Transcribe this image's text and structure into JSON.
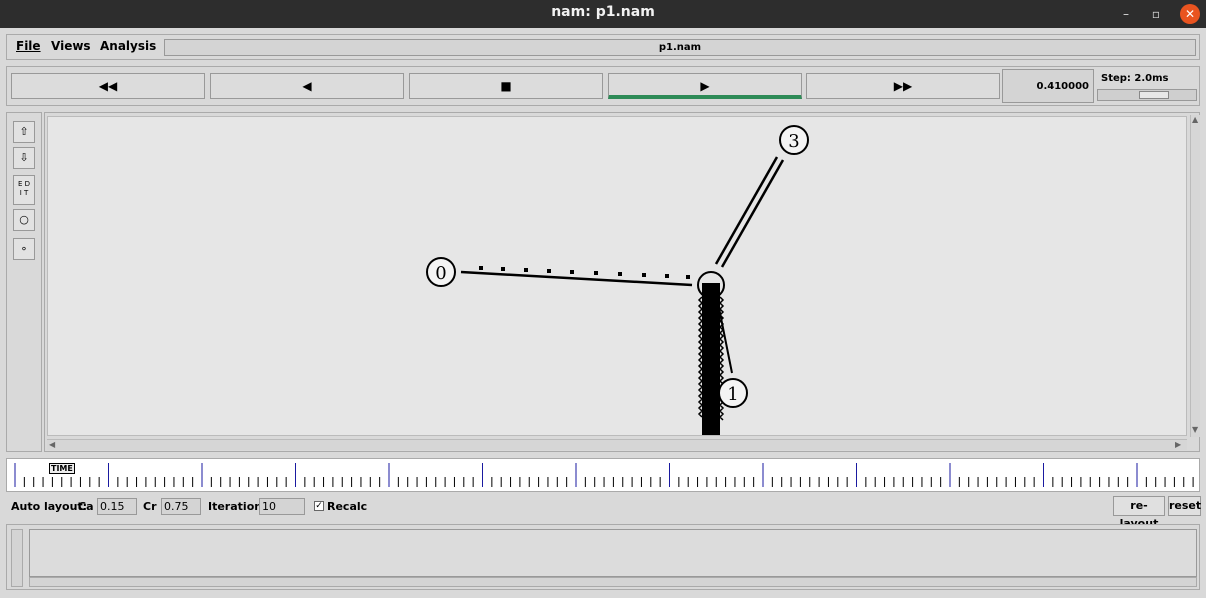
{
  "window": {
    "title": "nam: p1.nam",
    "min": "–",
    "max": "▫",
    "close": "✕"
  },
  "menu": {
    "file": "File",
    "views": "Views",
    "analysis": "Analysis",
    "filename": "p1.nam"
  },
  "controls": {
    "rewind": "◀◀",
    "back": "◀",
    "stop": "■",
    "play": "▶",
    "fastforward": "▶▶",
    "time": "0.410000",
    "step_label": "Step: 2.0ms"
  },
  "tools": {
    "zoom_in": "⇧",
    "zoom_out": "⇩",
    "edit": "E D\nI T",
    "circle_big": "○",
    "circle_small": "∘"
  },
  "nodes": [
    {
      "id": "0"
    },
    {
      "id": "1"
    },
    {
      "id": "3"
    }
  ],
  "timeline": {
    "label": "TIME"
  },
  "autolayout": {
    "label": "Auto layout:",
    "ca_label": "Ca",
    "ca_value": "0.15",
    "cr_label": "Cr",
    "cr_value": "0.75",
    "iter_label": "Iterations",
    "iter_value": "10",
    "recalc_label": "Recalc",
    "recalc_checked": "✓",
    "relayout": "re-layout",
    "reset": "reset"
  },
  "colors": {
    "play_active": "#2e8b57",
    "titlebar": "#2d2d2d",
    "close": "#e95420",
    "timeline_major": "#1a1aa0"
  }
}
